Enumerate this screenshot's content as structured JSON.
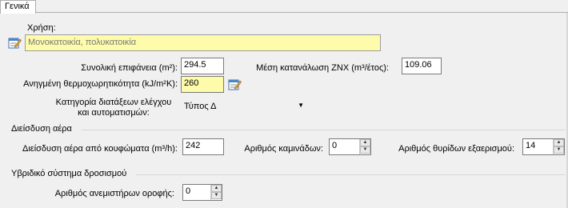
{
  "tab": {
    "label": "Γενικά"
  },
  "usage": {
    "label": "Χρήση:",
    "value": "Μονοκατοικία, πολυκατοικία"
  },
  "area": {
    "label": "Συνολική επιφάνεια (m²):",
    "value": "294.5"
  },
  "dhw": {
    "label": "Μέση κατανάλωση ZNX (m³/έτος):",
    "value": "109.06"
  },
  "heat_capacity": {
    "label": "Ανηγμένη θερμοχωρητικότητα (kJ/m²K):",
    "value": "260"
  },
  "control_category": {
    "label_line1": "Κατηγορία διατάξεων ελέγχου",
    "label_line2": "και αυτοματισμών:",
    "value": "Τύπος Δ"
  },
  "air_infiltration": {
    "title": "Διείσδυση αέρα",
    "openings_label": "Διείσδυση αέρα από κουφώματα (m³/h):",
    "openings_value": "242",
    "chimneys_label": "Αριθμός καμινάδων:",
    "chimneys_value": "0",
    "vents_label": "Αριθμός θυρίδων εξαερισμού:",
    "vents_value": "14"
  },
  "hybrid_cooling": {
    "title": "Υβριδικό σύστημα δροσισμού",
    "fans_label": "Αριθμός ανεμιστήρων οροφής:",
    "fans_value": "0"
  },
  "icons": {
    "edit": "edit-notepad-icon"
  },
  "colors": {
    "highlight": "#fefcaa",
    "panel": "#f0f0f0"
  }
}
